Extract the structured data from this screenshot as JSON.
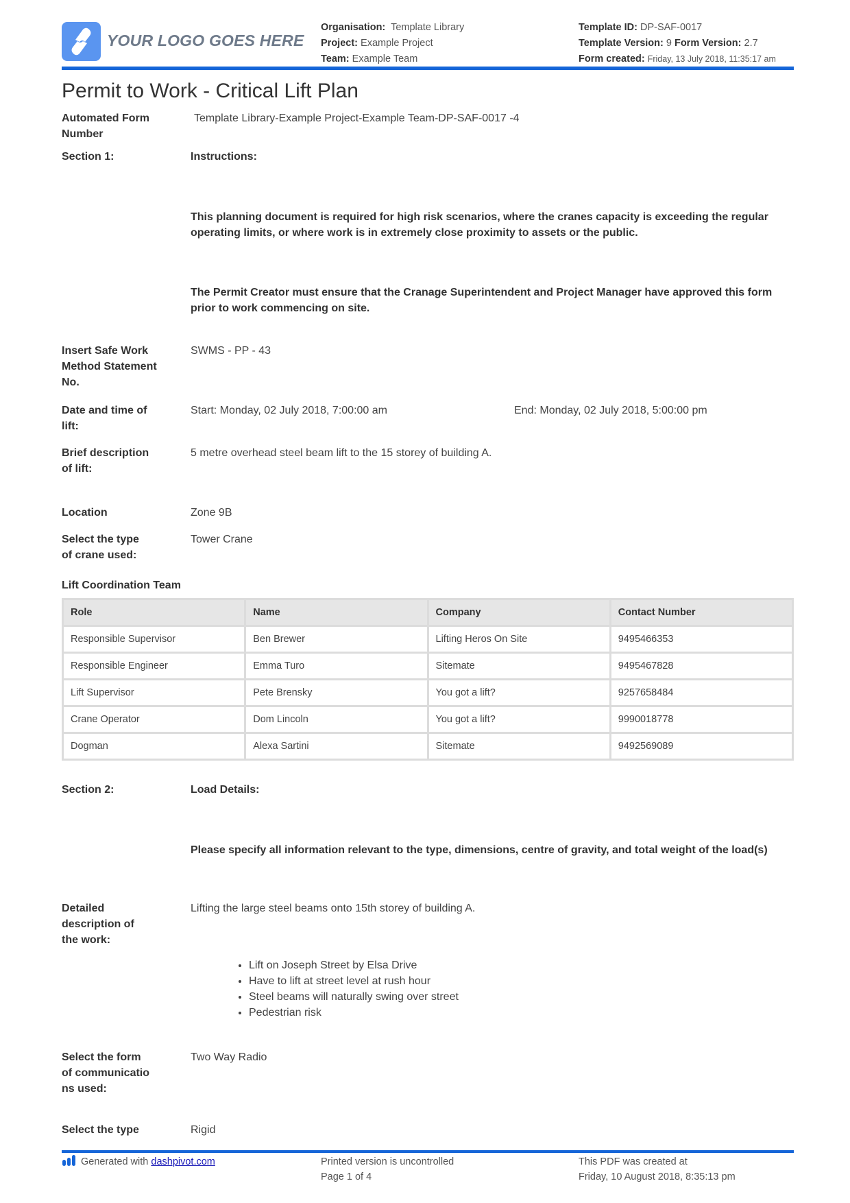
{
  "header": {
    "logo_text": "YOUR LOGO GOES HERE",
    "organisation_label": "Organisation:",
    "organisation_value": "Template Library",
    "project_label": "Project:",
    "project_value": "Example Project",
    "team_label": "Team:",
    "team_value": "Example Team",
    "template_id_label": "Template ID:",
    "template_id_value": "DP-SAF-0017",
    "template_version_label": "Template Version:",
    "template_version_value": "9",
    "form_version_label": "Form Version:",
    "form_version_value": "2.7",
    "form_created_label": "Form created:",
    "form_created_value": "Friday, 13 July 2018, 11:35:17 am",
    "accent_color": "#1565d8"
  },
  "document": {
    "title": "Permit to Work - Critical Lift Plan",
    "fields": {
      "form_number": {
        "label": "Automated Form Number",
        "value": "Template Library-Example Project-Example Team-DP-SAF-0017   -4"
      },
      "section1": {
        "label": "Section 1:",
        "value": "Instructions:"
      },
      "instruction1": "This planning document is required for high risk scenarios, where the cranes capacity is exceeding the regular operating limits, or where work is in extremely close proximity to assets or the public.",
      "instruction2": "The Permit Creator must ensure that the Cranage Superintendent and Project Manager have approved this form prior to work commencing on site.",
      "swms": {
        "label": "Insert Safe Work Method Statement No.",
        "value": "SWMS - PP - 43"
      },
      "datetime": {
        "label": "Date and time of lift:",
        "start": "Start: Monday, 02 July 2018, 7:00:00 am",
        "end": "End: Monday, 02 July 2018, 5:00:00 pm"
      },
      "brief": {
        "label": "Brief description of lift:",
        "value": "5 metre overhead steel beam lift to the 15 storey of building A."
      },
      "location": {
        "label": "Location",
        "value": "Zone 9B"
      },
      "crane_type": {
        "label": "Select the type of crane used:",
        "value": "Tower Crane"
      },
      "section2": {
        "label": "Section 2:",
        "value": "Load Details:"
      },
      "load_instruction": "Please specify all information relevant to the type, dimensions, centre of gravity, and total weight of the load(s)",
      "detailed": {
        "label": "Detailed description of the work:",
        "value": "Lifting the large steel beams onto 15th storey of building A."
      },
      "bullets": [
        "Lift on Joseph Street by Elsa Drive",
        "Have to lift at street level at rush hour",
        "Steel beams will naturally swing over street",
        "Pedestrian risk"
      ],
      "communication": {
        "label": "Select the form of communications used:",
        "value": "Two Way Radio"
      },
      "select_type": {
        "label": "Select the type",
        "value": "Rigid"
      }
    },
    "team_table": {
      "title": "Lift Coordination Team",
      "columns": [
        "Role",
        "Name",
        "Company",
        "Contact Number"
      ],
      "rows": [
        [
          "Responsible Supervisor",
          "Ben Brewer",
          "Lifting Heros On Site",
          "9495466353"
        ],
        [
          "Responsible Engineer",
          "Emma Turo",
          "Sitemate",
          "9495467828"
        ],
        [
          "Lift Supervisor",
          "Pete Brensky",
          "You got a lift?",
          "9257658484"
        ],
        [
          "Crane Operator",
          "Dom Lincoln",
          "You got a lift?",
          "9990018778"
        ],
        [
          "Dogman",
          "Alexa Sartini",
          "Sitemate",
          "9492569089"
        ]
      ]
    }
  },
  "footer": {
    "generated_prefix": "Generated with",
    "generated_link": "dashpivot.com",
    "printed_notice": "Printed version is uncontrolled",
    "page": "Page 1 of 4",
    "pdf_created_label": "This PDF was created at",
    "pdf_created_value": "Friday, 10 August 2018, 8:35:13 pm"
  }
}
